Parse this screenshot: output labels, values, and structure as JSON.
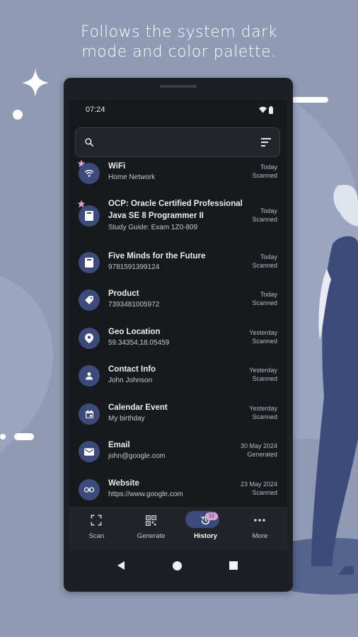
{
  "headline": {
    "line1": "Follows the system dark",
    "line2": "mode and color palette."
  },
  "colors": {
    "background": "#8f9bb5",
    "accent": "#3d4b7a",
    "star": "#d9a5d3",
    "screen": "#18191d"
  },
  "status": {
    "time": "07:24"
  },
  "search": {
    "value": "",
    "placeholder": ""
  },
  "history": [
    {
      "icon": "wifi-icon",
      "starred": true,
      "title_lines": [
        "WiFi"
      ],
      "subtitle": "Home Network",
      "date": "Today",
      "state": "Scanned"
    },
    {
      "icon": "book-icon",
      "starred": true,
      "title_lines": [
        "OCP: Oracle Certified Professional",
        "Java SE 8 Programmer II"
      ],
      "subtitle": "Study Guide: Exam 1Z0-809",
      "date": "Today",
      "state": "Scanned"
    },
    {
      "icon": "book-icon",
      "starred": false,
      "title_lines": [
        "Five Minds for the Future"
      ],
      "subtitle": "9781591399124",
      "date": "Today",
      "state": "Scanned"
    },
    {
      "icon": "tag-icon",
      "starred": false,
      "title_lines": [
        "Product"
      ],
      "subtitle": "7393481005972",
      "date": "Today",
      "state": "Scanned"
    },
    {
      "icon": "location-pin-icon",
      "starred": false,
      "title_lines": [
        "Geo Location"
      ],
      "subtitle": "59.34354,18.05459",
      "date": "Yesterday",
      "state": "Scanned"
    },
    {
      "icon": "person-icon",
      "starred": false,
      "title_lines": [
        "Contact Info"
      ],
      "subtitle": "John Johnson",
      "date": "Yesterday",
      "state": "Scanned"
    },
    {
      "icon": "calendar-icon",
      "starred": false,
      "title_lines": [
        "Calendar Event"
      ],
      "subtitle": "My birthday",
      "date": "Yesterday",
      "state": "Scanned"
    },
    {
      "icon": "email-icon",
      "starred": false,
      "title_lines": [
        "Email"
      ],
      "subtitle": "john@google.com",
      "date": "30 May 2024",
      "state": "Generated"
    },
    {
      "icon": "link-icon",
      "starred": false,
      "title_lines": [
        "Website"
      ],
      "subtitle": "https://www.google.com",
      "date": "23 May 2024",
      "state": "Scanned"
    }
  ],
  "nav": {
    "items": [
      {
        "label": "Scan",
        "icon": "scan-icon"
      },
      {
        "label": "Generate",
        "icon": "qr-grid-icon"
      },
      {
        "label": "History",
        "icon": "history-icon",
        "active": true,
        "badge": "12"
      },
      {
        "label": "More",
        "icon": "more-dots-icon"
      }
    ]
  }
}
